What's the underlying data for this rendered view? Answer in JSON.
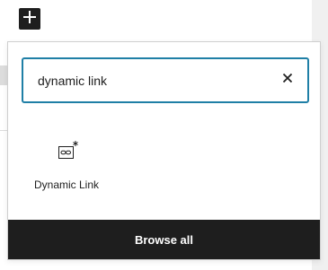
{
  "toolbar": {
    "inserter_icon": "plus-icon"
  },
  "search": {
    "value": "dynamic link",
    "clear_icon": "close-icon",
    "accent_color": "#1f7fa6"
  },
  "results": [
    {
      "label": "Dynamic Link",
      "icon": "dynamic-link-icon"
    }
  ],
  "footer": {
    "browse_all_label": "Browse all",
    "background_color": "#1e1e1e"
  }
}
